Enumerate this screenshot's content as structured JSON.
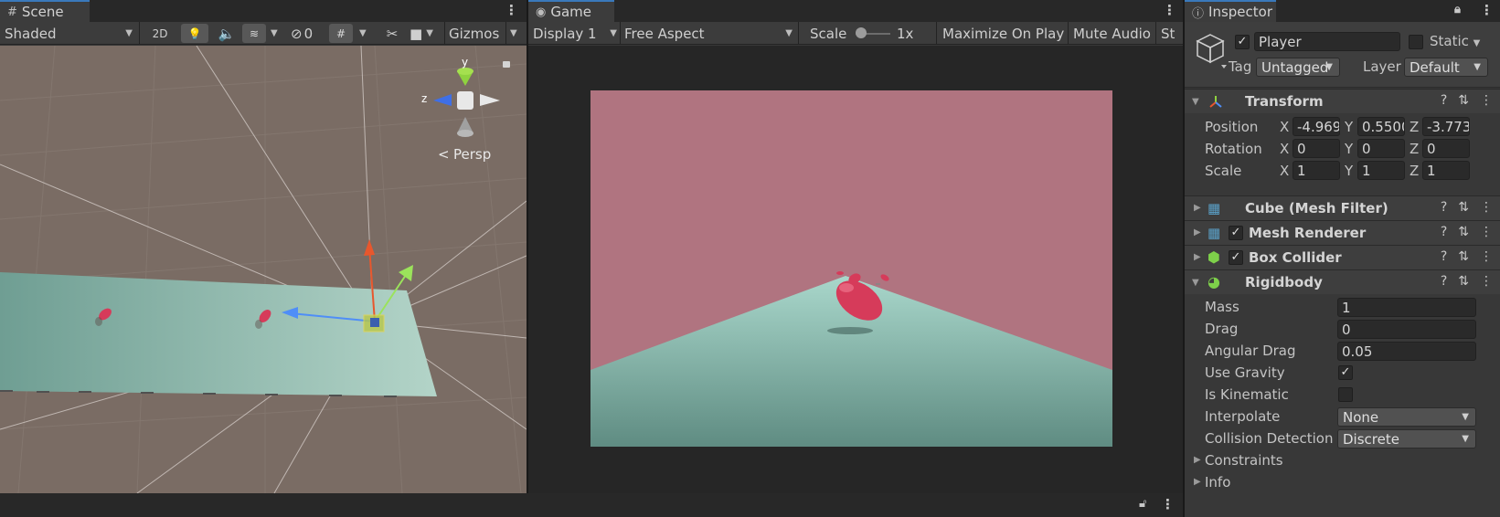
{
  "scene": {
    "tab_label": "Scene",
    "shading_mode": "Shaded",
    "mode_2d": "2D",
    "hidden_count": "0",
    "gizmos_label": "Gizmos",
    "persp_label": "Persp",
    "axis_y": "y",
    "axis_z": "z"
  },
  "game": {
    "tab_label": "Game",
    "display": "Display 1",
    "aspect": "Free Aspect",
    "scale_label": "Scale",
    "scale_value": "1x",
    "maximize_label": "Maximize On Play",
    "mute_label": "Mute Audio",
    "stats_label": "St"
  },
  "inspector": {
    "tab_label": "Inspector",
    "object_name": "Player",
    "object_active": true,
    "static_label": "Static",
    "tag_label": "Tag",
    "tag_value": "Untagged",
    "layer_label": "Layer",
    "layer_value": "Default",
    "transform": {
      "title": "Transform",
      "position_label": "Position",
      "rotation_label": "Rotation",
      "scale_label": "Scale",
      "position": {
        "x": "-4.969",
        "y": "0.5500",
        "z": "-3.773"
      },
      "rotation": {
        "x": "0",
        "y": "0",
        "z": "0"
      },
      "scale": {
        "x": "1",
        "y": "1",
        "z": "1"
      },
      "axis_x": "X",
      "axis_y": "Y",
      "axis_z": "Z"
    },
    "mesh_filter_title": "Cube (Mesh Filter)",
    "mesh_renderer_title": "Mesh Renderer",
    "box_collider_title": "Box Collider",
    "rigidbody": {
      "title": "Rigidbody",
      "mass_label": "Mass",
      "mass": "1",
      "drag_label": "Drag",
      "drag": "0",
      "angular_drag_label": "Angular Drag",
      "angular_drag": "0.05",
      "use_gravity_label": "Use Gravity",
      "use_gravity": true,
      "is_kinematic_label": "Is Kinematic",
      "is_kinematic": false,
      "interpolate_label": "Interpolate",
      "interpolate": "None",
      "collision_label": "Collision Detection",
      "collision": "Discrete",
      "constraints_label": "Constraints",
      "info_label": "Info"
    }
  },
  "colors": {
    "accent": "#3a79bb",
    "sky": "#b07480",
    "ground": "#87b8ab",
    "player": "#d63b5a"
  }
}
